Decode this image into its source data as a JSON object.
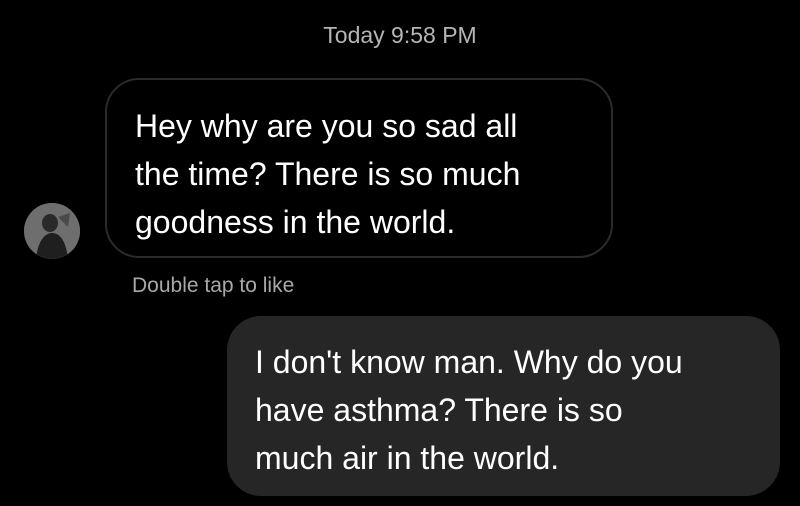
{
  "thread": {
    "timestamp": "Today 9:58 PM",
    "like_hint": "Double tap to like"
  },
  "messages": [
    {
      "direction": "incoming",
      "lines": [
        "Hey why are you so sad all",
        "the time? There is so much",
        "goodness in the world."
      ]
    },
    {
      "direction": "outgoing",
      "lines": [
        "I don't know man. Why do you",
        "have asthma? There is so",
        "much air in the world."
      ]
    }
  ],
  "colors": {
    "background": "#000000",
    "incoming_bubble_border": "#2b2b2b",
    "outgoing_bubble": "#262626",
    "text": "#ffffff",
    "meta_text": "#b5b5b5"
  },
  "icons": {
    "avatar": "sender-avatar"
  }
}
